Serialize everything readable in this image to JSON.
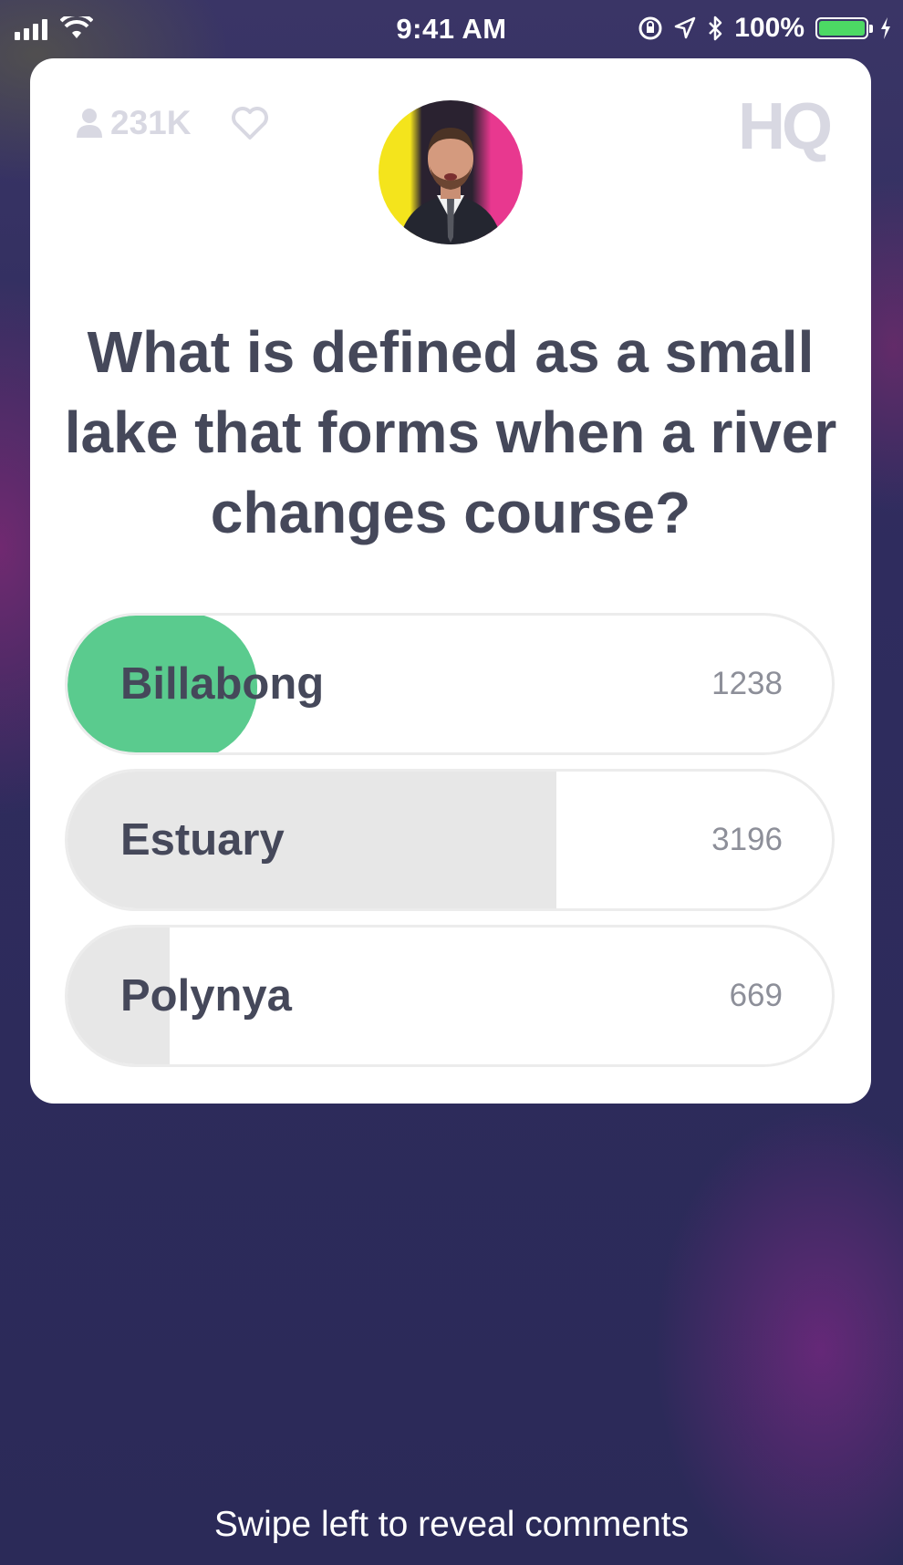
{
  "status_bar": {
    "time": "9:41 AM",
    "battery": "100%",
    "battery_fill_fraction": 1.0,
    "battery_color": "#4cd964"
  },
  "header": {
    "viewer_count": "231K",
    "logo": "HQ",
    "icons": [
      "person-icon",
      "heart-icon"
    ]
  },
  "question": {
    "text": "What is defined as a small lake that forms when a river changes course?"
  },
  "answers": [
    {
      "label": "Billabong",
      "count": "1238",
      "votes": 1238,
      "correct": true
    },
    {
      "label": "Estuary",
      "count": "3196",
      "votes": 3196,
      "correct": false
    },
    {
      "label": "Polynya",
      "count": "669",
      "votes": 669,
      "correct": false
    }
  ],
  "colors": {
    "correct": "#5acb8e",
    "bar": "#e7e7e7",
    "text": "#45485a"
  },
  "footer": {
    "hint": "Swipe left to reveal comments"
  }
}
